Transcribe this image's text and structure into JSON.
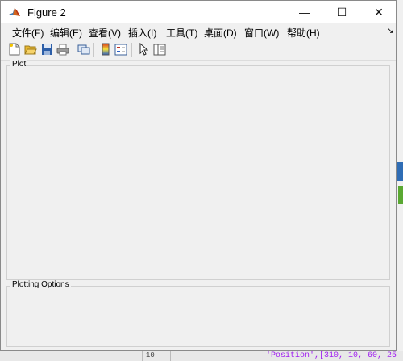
{
  "window": {
    "title": "Figure 2",
    "controls": {
      "minimize": "—",
      "maximize": "☐",
      "close": "✕"
    }
  },
  "menu": {
    "items": [
      "文件(F)",
      "编辑(E)",
      "查看(V)",
      "插入(I)",
      "工具(T)",
      "桌面(D)",
      "窗口(W)",
      "帮助(H)"
    ],
    "dock_arrow": "↘"
  },
  "toolbar": {
    "buttons": [
      "new-figure-icon",
      "open-file-icon",
      "save-icon",
      "print-icon",
      "link-plot-icon",
      "insert-colorbar-icon",
      "insert-legend-icon",
      "edit-plot-arrow-icon",
      "property-inspector-icon"
    ]
  },
  "panels": {
    "plot_title": "Plot",
    "options_title": "Plotting Options"
  },
  "background": {
    "row_number": "10",
    "code_text": "'Position',[310, 10, 60, 25"
  },
  "colors": {
    "window_bg": "#f0f0f0",
    "titlebar_bg": "#ffffff",
    "desktop_bg": "#6d6d6d",
    "code_purple": "#a020f0"
  }
}
